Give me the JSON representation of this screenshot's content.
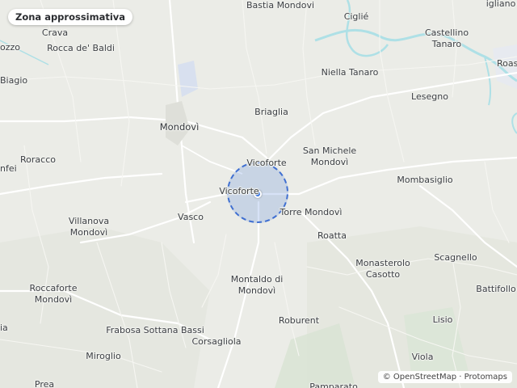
{
  "map": {
    "badge_label": "Zona approssimativa",
    "attribution": {
      "osm": "© OpenStreetMap",
      "separator": " · ",
      "protomaps": "Protomaps"
    },
    "colors": {
      "land": "#ebece7",
      "water": "#aee0e6",
      "accuracy_fill": "#608cdc",
      "accuracy_stroke": "#3f6fd1",
      "location_dot": "#2f6fe0"
    },
    "places": [
      {
        "key": "bastia_mondovi",
        "label": "Bastia Mondovi"
      },
      {
        "key": "cigliè",
        "label": "Ciglié"
      },
      {
        "key": "igliano",
        "label": "igliano"
      },
      {
        "key": "crava",
        "label": "Crava"
      },
      {
        "key": "rocca_de_baldi",
        "label": "Rocca de' Baldi"
      },
      {
        "key": "castellino",
        "label": "Castellino\nTanaro"
      },
      {
        "key": "ozzo",
        "label": "ozzo"
      },
      {
        "key": "roas",
        "label": "Roas"
      },
      {
        "key": "biagio",
        "label": "Biagio"
      },
      {
        "key": "niella",
        "label": "Niella Tanaro"
      },
      {
        "key": "lesegno",
        "label": "Lesegno"
      },
      {
        "key": "briaglia",
        "label": "Briaglia"
      },
      {
        "key": "mondovi",
        "label": "Mondovì"
      },
      {
        "key": "roracco",
        "label": "Roracco"
      },
      {
        "key": "nfei",
        "label": "nfei"
      },
      {
        "key": "vicoforte_n",
        "label": "Vicoforte"
      },
      {
        "key": "san_michele",
        "label": "San Michele\nMondovì"
      },
      {
        "key": "mombasiglio",
        "label": "Mombasiglio"
      },
      {
        "key": "vicoforte_w",
        "label": "Vicoforte"
      },
      {
        "key": "vasco",
        "label": "Vasco"
      },
      {
        "key": "torre_mondovi",
        "label": "Torre Mondovì"
      },
      {
        "key": "villanova",
        "label": "Villanova\nMondovì"
      },
      {
        "key": "roatta",
        "label": "Roatta"
      },
      {
        "key": "scagnello",
        "label": "Scagnello"
      },
      {
        "key": "monasterolo",
        "label": "Monasterolo\nCasotto"
      },
      {
        "key": "montaldo",
        "label": "Montaldo di\nMondovì"
      },
      {
        "key": "battifollo",
        "label": "Battifollo"
      },
      {
        "key": "roccaforte",
        "label": "Roccaforte\nMondovì"
      },
      {
        "key": "roburent",
        "label": "Roburent"
      },
      {
        "key": "lisio",
        "label": "Lisio"
      },
      {
        "key": "ia",
        "label": "ia"
      },
      {
        "key": "frabosa",
        "label": "Frabosa Sottana Bassi"
      },
      {
        "key": "corsagliola",
        "label": "Corsagliola"
      },
      {
        "key": "miroglio",
        "label": "Miroglio"
      },
      {
        "key": "viola",
        "label": "Viola"
      },
      {
        "key": "prea",
        "label": "Prea"
      },
      {
        "key": "pamparato",
        "label": "Pamparato"
      }
    ]
  }
}
